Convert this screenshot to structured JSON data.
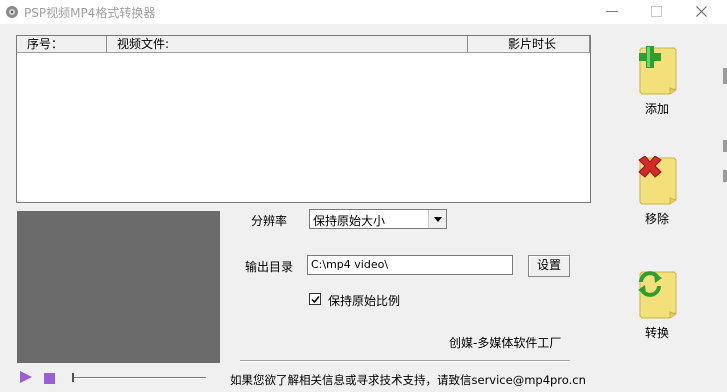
{
  "window": {
    "title": "PSP视频MP4格式转换器"
  },
  "titlebar": {
    "minimize_symbol": "—",
    "maximize_icon": "maximize-icon",
    "close_icon": "close-icon"
  },
  "file_list": {
    "columns": [
      "序号：",
      "视频文件:",
      "影片时长"
    ],
    "rows": []
  },
  "player": {
    "play_icon": "play-icon",
    "stop_icon": "stop-icon",
    "accent_color": "#9a5fd4"
  },
  "settings": {
    "resolution_label": "分辨率",
    "resolution_value": "保持原始大小",
    "output_dir_label": "输出目录",
    "output_dir_value": "C:\\mp4 video\\",
    "browse_button": "设置",
    "keep_ratio_label": "保持原始比例",
    "keep_ratio_checked": true
  },
  "footer": {
    "credit": "创媒-多媒体软件工厂",
    "contact": "如果您欲了解相关信息或寻求技术支持，请致信service@mp4pro.cn"
  },
  "actions": [
    {
      "label": "添加",
      "icon": "add-file-icon"
    },
    {
      "label": "移除",
      "icon": "remove-file-icon"
    },
    {
      "label": "转换",
      "icon": "convert-file-icon"
    }
  ]
}
